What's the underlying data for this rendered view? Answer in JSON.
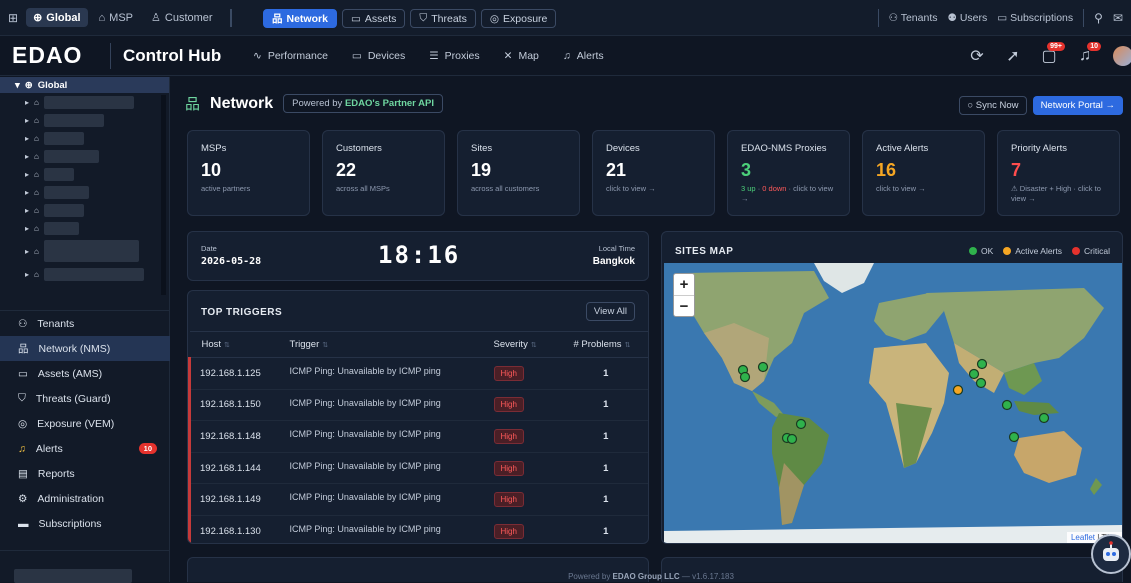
{
  "topbar": {
    "scopes": [
      {
        "label": "Global",
        "active": true
      },
      {
        "label": "MSP",
        "active": false
      },
      {
        "label": "Customer",
        "active": false
      }
    ],
    "products": [
      {
        "label": "Network",
        "active": true
      },
      {
        "label": "Assets",
        "active": false
      },
      {
        "label": "Threats",
        "active": false
      },
      {
        "label": "Exposure",
        "active": false
      }
    ],
    "right_links": [
      "Tenants",
      "Users",
      "Subscriptions"
    ]
  },
  "header": {
    "logo": "EDAO",
    "app_title": "Control Hub",
    "nav": [
      "Performance",
      "Devices",
      "Proxies",
      "Map",
      "Alerts"
    ],
    "messages_badge": "99+",
    "notifications_badge": "10"
  },
  "sidebar": {
    "tree_root": "Global",
    "menu": [
      {
        "label": "Tenants",
        "icon": "tenants-icon",
        "active": false
      },
      {
        "label": "Network (NMS)",
        "icon": "network-icon",
        "active": true
      },
      {
        "label": "Assets (AMS)",
        "icon": "assets-icon",
        "active": false
      },
      {
        "label": "Threats (Guard)",
        "icon": "shield-icon",
        "active": false
      },
      {
        "label": "Exposure (VEM)",
        "icon": "exposure-icon",
        "active": false
      },
      {
        "label": "Alerts",
        "icon": "bell-icon",
        "active": false,
        "badge": "10"
      },
      {
        "label": "Reports",
        "icon": "report-icon",
        "active": false
      },
      {
        "label": "Administration",
        "icon": "gear-icon",
        "active": false
      },
      {
        "label": "Subscriptions",
        "icon": "card-icon",
        "active": false
      }
    ]
  },
  "page": {
    "title": "Network",
    "powered_prefix": "Powered by ",
    "powered_brand": "EDAO's Partner API",
    "sync_label": "○ Sync Now",
    "portal_label": "Network Portal →"
  },
  "cards": [
    {
      "label": "MSPs",
      "value": "10",
      "sub": "active partners",
      "color": "#ffffff"
    },
    {
      "label": "Customers",
      "value": "22",
      "sub": "across all MSPs",
      "color": "#ffffff"
    },
    {
      "label": "Sites",
      "value": "19",
      "sub": "across all customers",
      "color": "#ffffff"
    },
    {
      "label": "Devices",
      "value": "21",
      "sub": "click to view →",
      "color": "#ffffff"
    },
    {
      "label": "EDAO-NMS Proxies",
      "value": "3",
      "sub_up": "3 up",
      "sub_sep": " · ",
      "sub_down": "0 down",
      "sub_rest": " · click to view →",
      "color": "#4cd07a"
    },
    {
      "label": "Active Alerts",
      "value": "16",
      "sub": "click to view →",
      "color": "#f5a623"
    },
    {
      "label": "Priority Alerts",
      "value": "7",
      "sub": "⚠ Disaster + High · click to view →",
      "color": "#ff4d4d"
    }
  ],
  "clock": {
    "date_label": "Date",
    "date_value": "2026-05-28",
    "time": "18:16",
    "tz_label": "Local Time",
    "tz_value": "Bangkok"
  },
  "triggers": {
    "title": "TOP TRIGGERS",
    "view_all": "View All",
    "columns": [
      "Host",
      "Trigger",
      "Severity",
      "# Problems"
    ],
    "rows": [
      {
        "host": "192.168.1.125",
        "trigger": "ICMP Ping: Unavailable by ICMP ping",
        "severity": "High",
        "problems": "1"
      },
      {
        "host": "192.168.1.150",
        "trigger": "ICMP Ping: Unavailable by ICMP ping",
        "severity": "High",
        "problems": "1"
      },
      {
        "host": "192.168.1.148",
        "trigger": "ICMP Ping: Unavailable by ICMP ping",
        "severity": "High",
        "problems": "1"
      },
      {
        "host": "192.168.1.144",
        "trigger": "ICMP Ping: Unavailable by ICMP ping",
        "severity": "High",
        "problems": "1"
      },
      {
        "host": "192.168.1.149",
        "trigger": "ICMP Ping: Unavailable by ICMP ping",
        "severity": "High",
        "problems": "1"
      },
      {
        "host": "192.168.1.130",
        "trigger": "ICMP Ping: Unavailable by ICMP ping",
        "severity": "High",
        "problems": "1"
      }
    ]
  },
  "map": {
    "title": "SITES MAP",
    "legend": [
      {
        "label": "OK",
        "color": "#2fb24c"
      },
      {
        "label": "Active Alerts",
        "color": "#f5a623"
      },
      {
        "label": "Critical",
        "color": "#e5322d"
      }
    ],
    "zoom_in": "+",
    "zoom_out": "−",
    "attribution_link": "Leaflet",
    "attribution_rest": " | Tiles"
  },
  "footer": {
    "prefix": "Powered by ",
    "brand": "EDAO Group LLC",
    "version": " — v1.6.17.183"
  }
}
